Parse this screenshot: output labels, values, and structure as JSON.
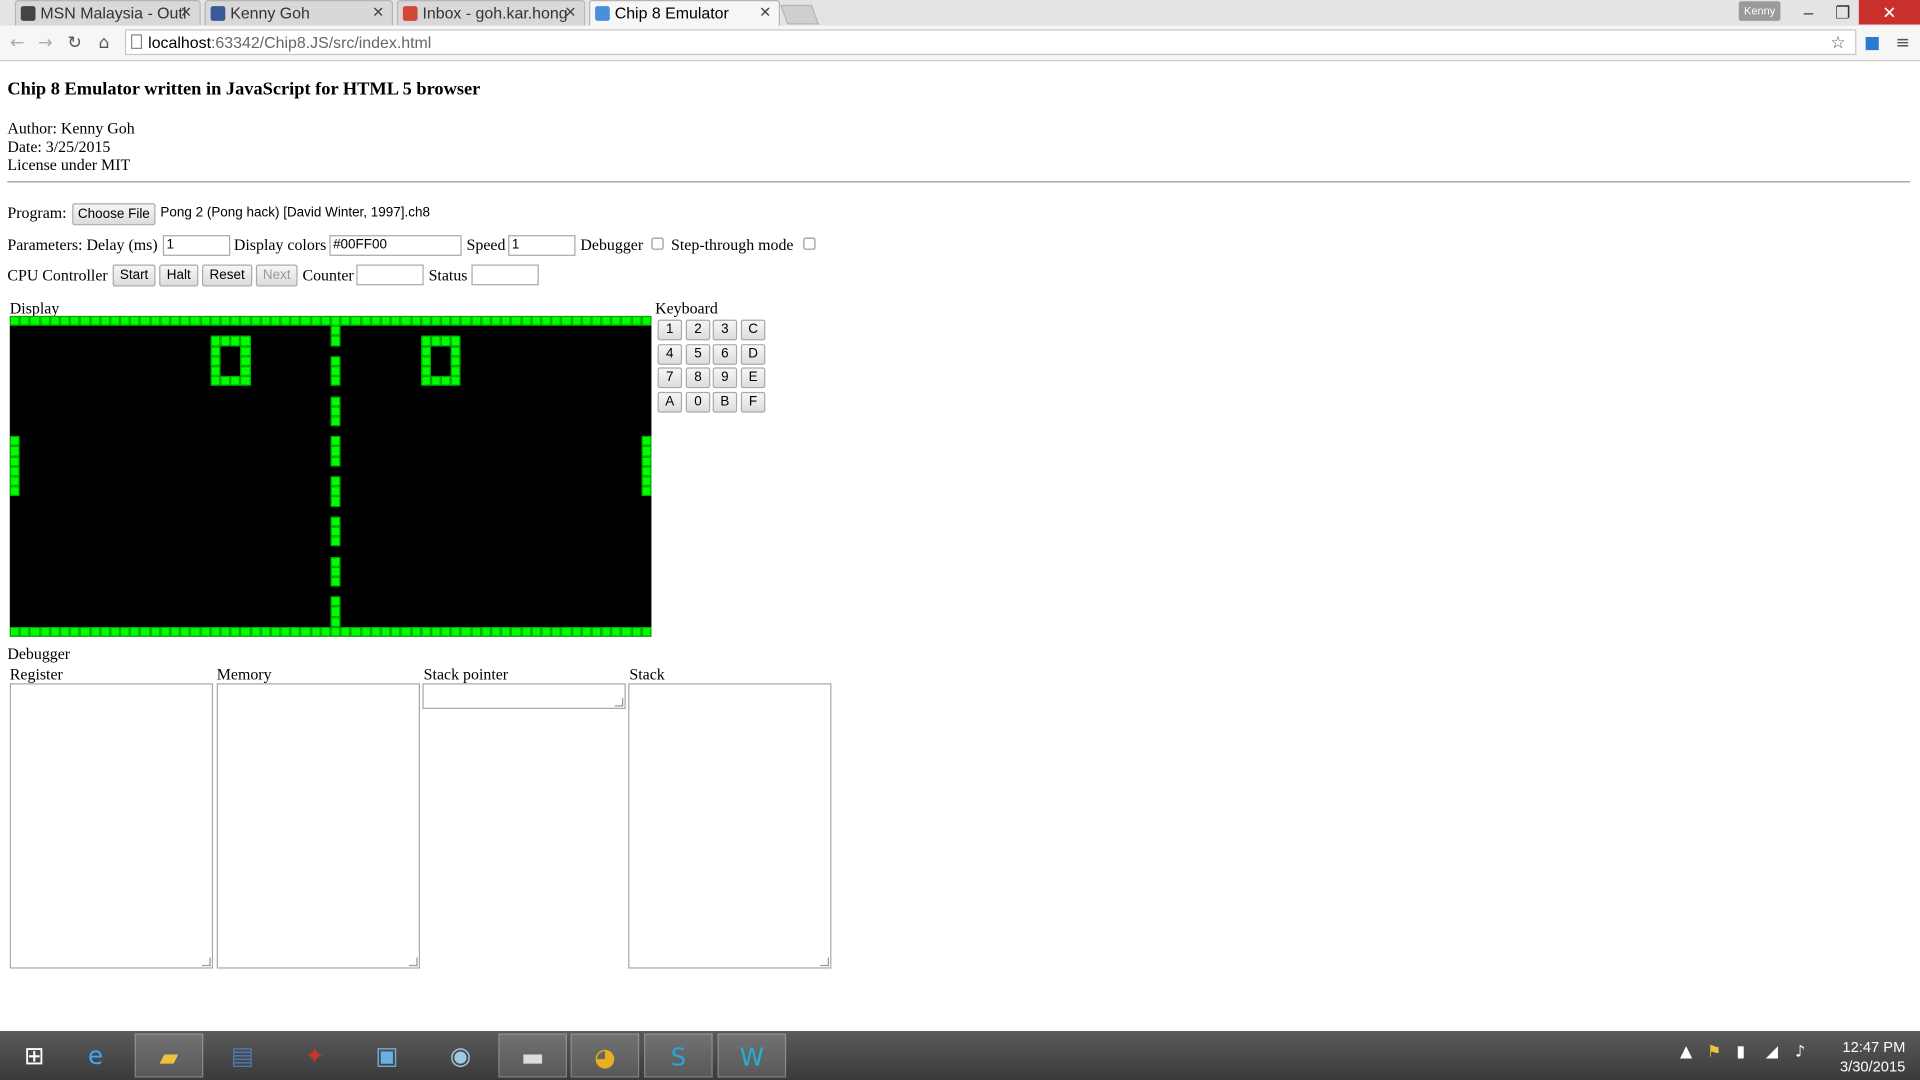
{
  "browser": {
    "tabs": [
      {
        "label": "MSN Malaysia - Outl",
        "icon": "msn-icon",
        "color": "#444444"
      },
      {
        "label": "Kenny Goh",
        "icon": "facebook-icon",
        "color": "#3b5998"
      },
      {
        "label": "Inbox - goh.kar.hong",
        "icon": "gmail-icon",
        "color": "#d14836"
      },
      {
        "label": "Chip 8 Emulator",
        "icon": "page-icon",
        "color": "#4a90d9"
      }
    ],
    "profile": "Kenny",
    "url_host": "localhost",
    "url_rest": ":63342/Chip8.JS/src/index.html"
  },
  "page": {
    "heading": "Chip 8 Emulator written in JavaScript for HTML 5 browser",
    "author": "Author: Kenny Goh",
    "date": "Date: 3/25/2015",
    "license": "License under MIT",
    "program_label": "Program:",
    "choose_file": "Choose File",
    "file_name": "Pong 2 (Pong hack) [David Winter, 1997].ch8",
    "parameters_label": "Parameters: Delay (ms)",
    "delay_value": "1",
    "display_colors_label": "Display colors",
    "display_colors_value": "#00FF00",
    "speed_label": "Speed",
    "speed_value": "1",
    "debugger_label": "Debugger",
    "step_through_label": "Step-through mode",
    "cpu_label": "CPU Controller",
    "start": "Start",
    "halt": "Halt",
    "reset": "Reset",
    "next": "Next",
    "counter_label": "Counter",
    "status_label": "Status",
    "display_label": "Display",
    "keyboard_label": "Keyboard",
    "keys": [
      "1",
      "2",
      "3",
      "C",
      "4",
      "5",
      "6",
      "D",
      "7",
      "8",
      "9",
      "E",
      "A",
      "0",
      "B",
      "F"
    ],
    "debugger_heading": "Debugger",
    "register_label": "Register",
    "memory_label": "Memory",
    "stack_pointer_label": "Stack pointer",
    "stack_label": "Stack",
    "pixel_color": "#00FF00"
  },
  "taskbar": {
    "clock_time": "12:47 PM",
    "clock_date": "3/30/2015"
  }
}
